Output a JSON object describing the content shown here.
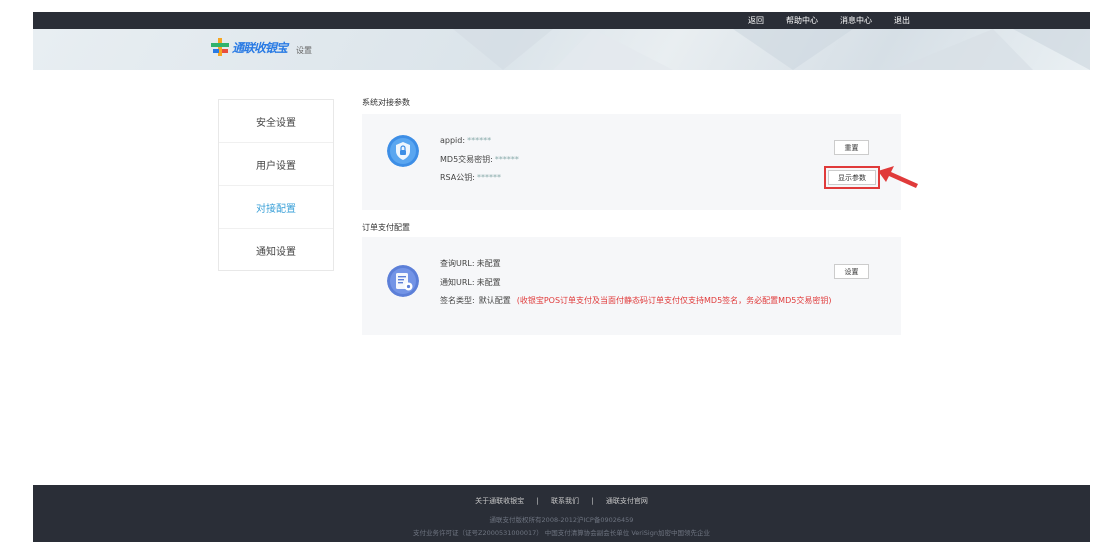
{
  "topnav": {
    "back": "返回",
    "help": "帮助中心",
    "messages": "消息中心",
    "logout": "退出"
  },
  "header": {
    "logo_text": "通联收银宝",
    "subtitle": "设置"
  },
  "sidebar": {
    "items": [
      {
        "label": "安全设置",
        "active": false
      },
      {
        "label": "用户设置",
        "active": false
      },
      {
        "label": "对接配置",
        "active": true
      },
      {
        "label": "通知设置",
        "active": false
      }
    ]
  },
  "system_params": {
    "title": "系统对接参数",
    "appid_label": "appid:",
    "appid_value": "******",
    "md5_label": "MD5交易密钥:",
    "md5_value": "******",
    "rsa_label": "RSA公钥:",
    "rsa_value": "******",
    "reset_button": "重置",
    "show_button": "显示参数"
  },
  "order_config": {
    "title": "订单支付配置",
    "query_label": "查询URL:",
    "query_value": "未配置",
    "notify_label": "通知URL:",
    "notify_value": "未配置",
    "sign_label": "签名类型:",
    "sign_value": "默认配置",
    "sign_note": "(收银宝POS订单支付及当面付静态码订单支付仅支持MD5签名，务必配置MD5交易密钥)",
    "set_button": "设置"
  },
  "footer": {
    "link_about": "关于通联收银宝",
    "link_contact": "联系我们",
    "link_official": "通联支付官网",
    "sep": "|",
    "copyright": "通联支付版权所有2008-2012沪ICP备09026459",
    "license": "支付业务许可证（证号Z2000531000017）   中国支付清算协会副会长单位   VeriSign加密中国领先企业"
  },
  "colors": {
    "accent": "#3aa0d8",
    "highlight": "#e03a3a",
    "dark": "#2a2e37"
  }
}
